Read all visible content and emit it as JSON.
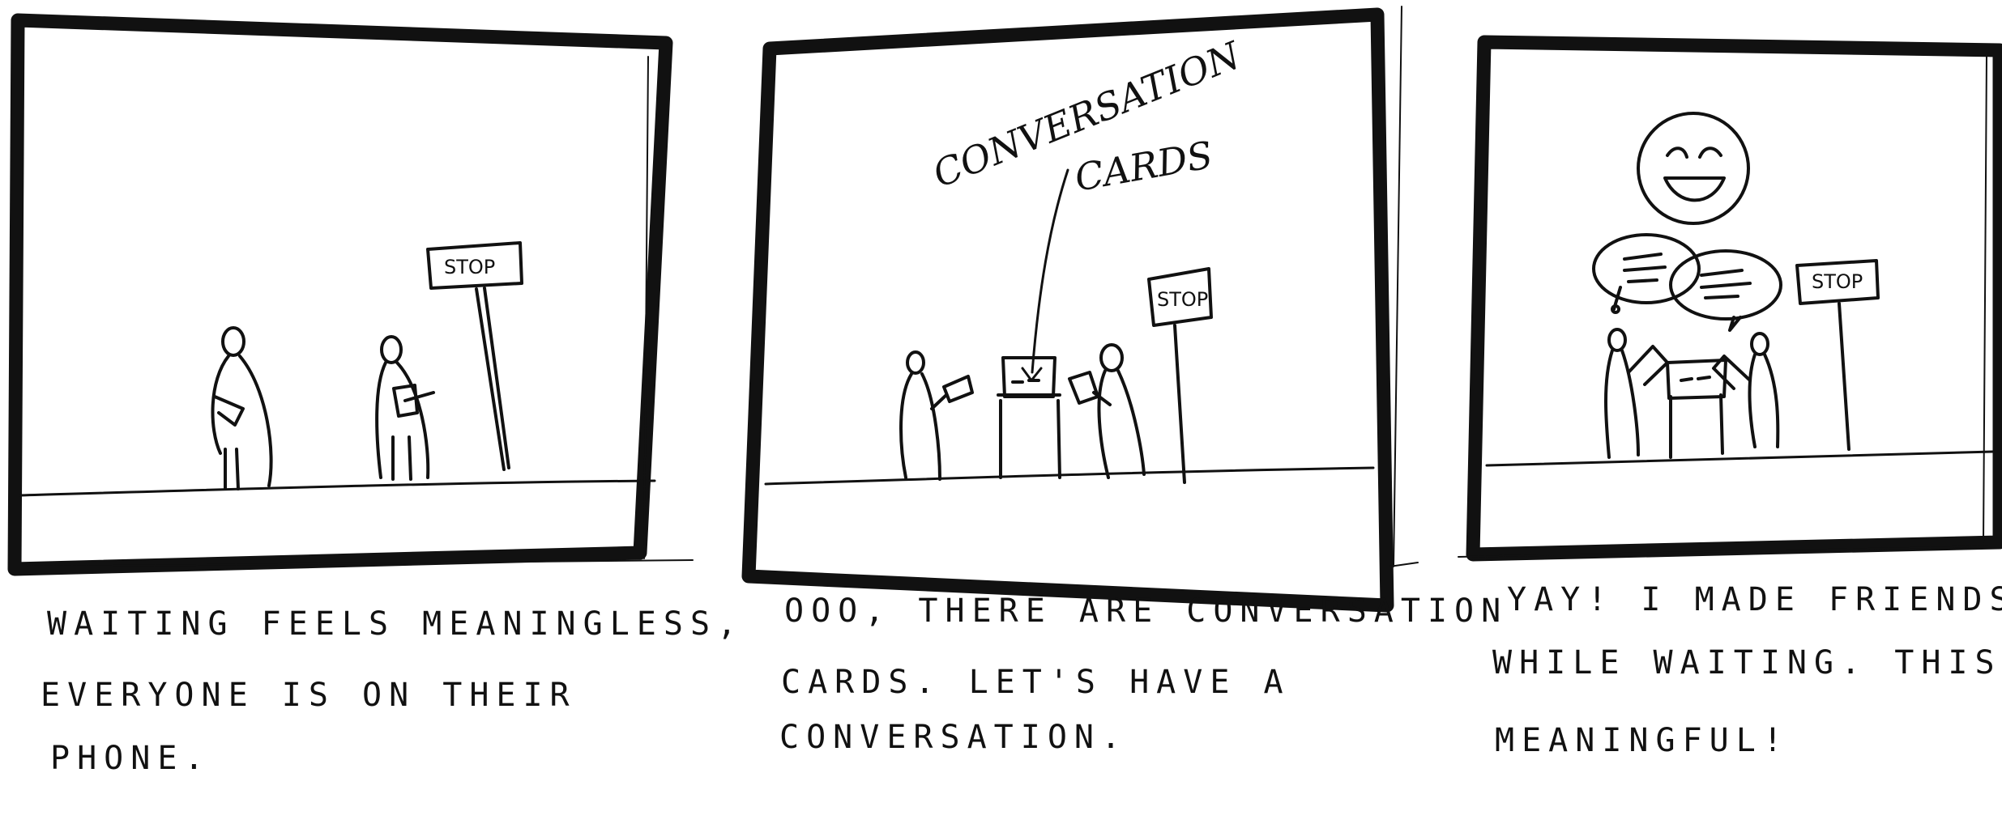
{
  "panels": [
    {
      "caption_lines": [
        "WAITING FEELS MEANINGLESS,",
        "EVERYONE IS ON THEIR",
        "PHONE."
      ],
      "sign": "STOP"
    },
    {
      "caption_lines": [
        "OOO, THERE ARE CONVERSATION",
        "CARDS. LET'S HAVE A",
        "CONVERSATION."
      ],
      "sign": "STOP",
      "label_lines": [
        "CONVERSATION",
        "CARDS"
      ]
    },
    {
      "caption_lines": [
        "YAY! I MADE FRIENDS",
        "WHILE WAITING. THIS IS",
        "MEANINGFUL!"
      ],
      "sign": "STOP"
    }
  ],
  "colors": {
    "ink": "#111111",
    "paper": "#ffffff"
  }
}
